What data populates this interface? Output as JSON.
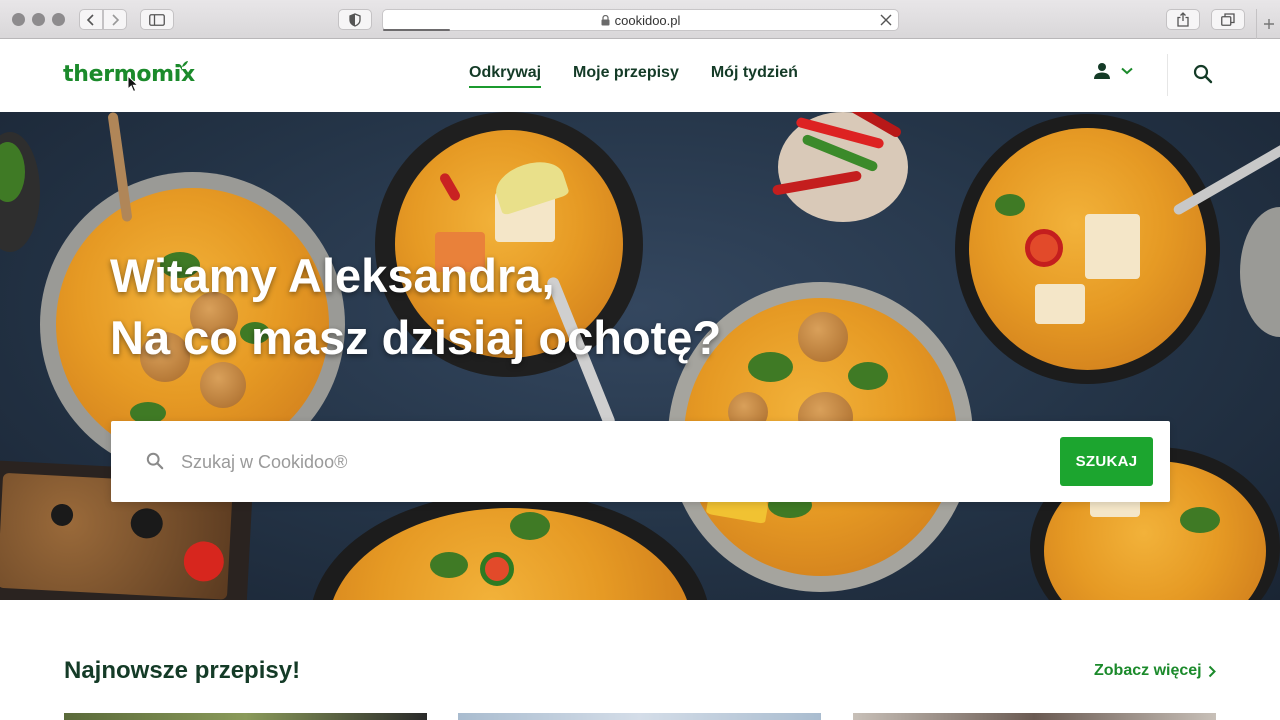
{
  "browser": {
    "url": "cookidoo.pl",
    "icons": [
      "back-icon",
      "forward-icon",
      "sidebar-icon",
      "shield-icon",
      "lock-icon",
      "close-icon",
      "share-icon",
      "tabs-icon",
      "plus-icon"
    ]
  },
  "header": {
    "logo": "thermomix",
    "nav": [
      {
        "label": "Odkrywaj",
        "active": true
      },
      {
        "label": "Moje przepisy",
        "active": false
      },
      {
        "label": "Mój tydzień",
        "active": false
      }
    ],
    "icons": [
      "user-icon",
      "chevron-down-icon",
      "search-icon"
    ]
  },
  "hero": {
    "greeting": "Witamy Aleksandra,",
    "question": "Na co masz dzisiaj ochotę?",
    "search": {
      "placeholder": "Szukaj w Cookidoo®",
      "button": "SZUKAJ"
    }
  },
  "recipes": {
    "title": "Najnowsze przepisy!",
    "see_more": "Zobacz więcej"
  },
  "colors": {
    "brand_green": "#1b8a2b",
    "button_green": "#1ca52f",
    "heading_dark": "#143b27",
    "hero_background": "#243447"
  }
}
